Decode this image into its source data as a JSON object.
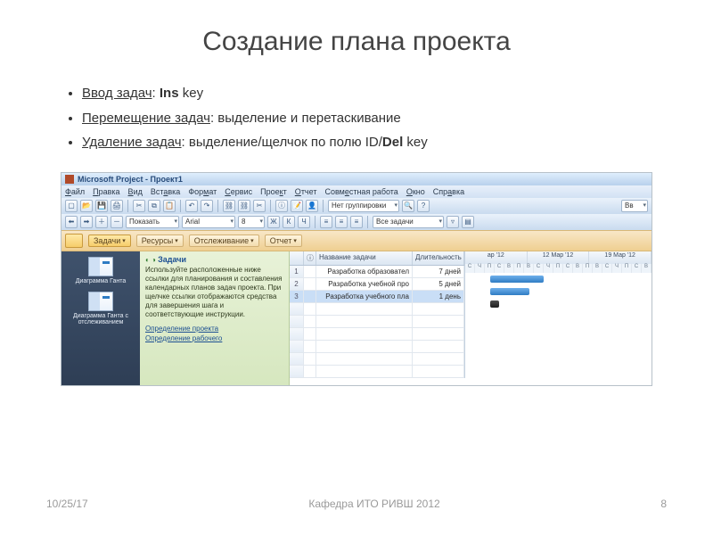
{
  "slide": {
    "title": "Создание плана проекта",
    "bullets": [
      {
        "label": "Ввод задач",
        "key": "Ins",
        "suffix": " key"
      },
      {
        "label": "Перемещение задач",
        "text": "выделение и перетаскивание"
      },
      {
        "label": "Удаление задач",
        "text": "выделение/щелчок по полю ID/",
        "key": "Del",
        "suffix": " key"
      }
    ]
  },
  "app": {
    "title": "Microsoft Project - Проект1",
    "menus": [
      "Файл",
      "Правка",
      "Вид",
      "Вставка",
      "Формат",
      "Сервис",
      "Проект",
      "Отчет",
      "Совместная работа",
      "Окно",
      "Справка"
    ],
    "toolbar1": {
      "show_label": "Показать",
      "font_name": "Arial",
      "font_size": "8",
      "group": "Нет группировки",
      "bold": "Ж",
      "italic": "К",
      "under": "Ч"
    },
    "toolbar2": {
      "tasks": "Все задачи"
    },
    "ribbon": {
      "tasks_btn": "Задачи",
      "resources_btn": "Ресурсы",
      "track_btn": "Отслеживание",
      "report_btn": "Отчет"
    },
    "left_nav": {
      "item1": "Диаграмма Ганта",
      "item2": "Диаграмма Ганта с отслеживанием"
    },
    "help": {
      "title": "Задачи",
      "body": "Используйте расположенные ниже ссылки для планирования и составления календарных планов задач проекта. При щелчке ссылки отображаются средства для завершения шага и соответствующие инструкции.",
      "link1": "Определение проекта",
      "link2": "Определение рабочего"
    },
    "table": {
      "cols": {
        "info": "ⓘ",
        "name": "Название задачи",
        "dur": "Длительность"
      },
      "rows": [
        {
          "id": "1",
          "name": "Разработка образовател",
          "dur": "7 дней"
        },
        {
          "id": "2",
          "name": "Разработка учебной про",
          "dur": "5 дней"
        },
        {
          "id": "3",
          "name": "Разработка учебного пла",
          "dur": "1 день"
        }
      ]
    },
    "gantt": {
      "weeks": [
        "ар '12",
        "12 Мар '12",
        "19 Мар '12"
      ],
      "days": [
        "С",
        "Ч",
        "П",
        "С",
        "В",
        "П",
        "В",
        "С",
        "Ч",
        "П",
        "С",
        "В",
        "П",
        "В",
        "С",
        "Ч",
        "П",
        "С",
        "В"
      ]
    }
  },
  "footer": {
    "date": "10/25/17",
    "center": "Кафедра ИТО РИВШ 2012",
    "page": "8"
  }
}
